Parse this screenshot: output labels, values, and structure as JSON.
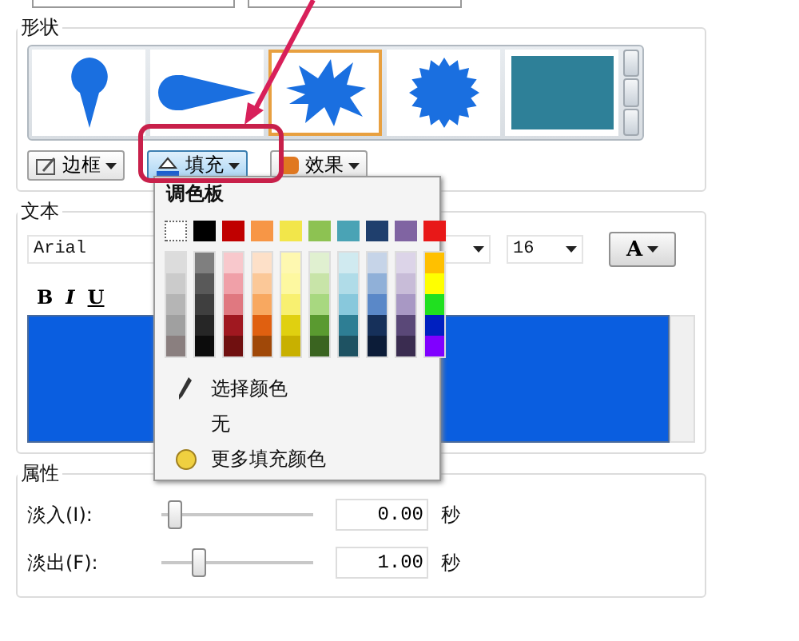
{
  "shape_group": {
    "title": "形状",
    "shapes": [
      {
        "kind": "pin",
        "selected": false
      },
      {
        "kind": "teardrop",
        "selected": false
      },
      {
        "kind": "burst",
        "selected": true
      },
      {
        "kind": "seal",
        "selected": false
      },
      {
        "kind": "rectangle",
        "selected": false
      }
    ],
    "buttons": [
      {
        "kind": "border",
        "label": "边框",
        "selected": false
      },
      {
        "kind": "fill",
        "label": "填充",
        "selected": true
      },
      {
        "kind": "effect",
        "label": "效果",
        "selected": false
      }
    ]
  },
  "text_group": {
    "title": "文本",
    "font": "Arial",
    "size": "16",
    "font_color_label": "A",
    "format_buttons": [
      {
        "kind": "bold",
        "label": "B"
      },
      {
        "kind": "italic",
        "label": "I"
      },
      {
        "kind": "underline",
        "label": "U"
      }
    ]
  },
  "fill_menu": {
    "title": "调色板",
    "top_colors": [
      {
        "kind": "none"
      },
      {
        "kind": "color",
        "color": "#000000"
      },
      {
        "kind": "color",
        "color": "#c00000"
      },
      {
        "kind": "color",
        "color": "#f79646"
      },
      {
        "kind": "color",
        "color": "#f2e64a"
      },
      {
        "kind": "color",
        "color": "#8dc252"
      },
      {
        "kind": "color",
        "color": "#4aa3b5"
      },
      {
        "kind": "color",
        "color": "#1f3f6d"
      },
      {
        "kind": "color",
        "color": "#8064a2"
      },
      {
        "kind": "color",
        "color": "#e81818"
      }
    ],
    "shade_columns": [
      {
        "shades": [
          {
            "color": "#dcdcdc"
          },
          {
            "color": "#cbcbcb"
          },
          {
            "color": "#b5b5b5"
          },
          {
            "color": "#a0a0a0"
          },
          {
            "color": "#8a7f7f"
          }
        ]
      },
      {
        "shades": [
          {
            "color": "#7f7f7f"
          },
          {
            "color": "#595959"
          },
          {
            "color": "#3f3f3f"
          },
          {
            "color": "#262626"
          },
          {
            "color": "#0c0c0c"
          }
        ]
      },
      {
        "shades": [
          {
            "color": "#f8c8cc"
          },
          {
            "color": "#f0a0a8"
          },
          {
            "color": "#e07880"
          },
          {
            "color": "#a01820"
          },
          {
            "color": "#701010"
          }
        ]
      },
      {
        "shades": [
          {
            "color": "#fde0c8"
          },
          {
            "color": "#fbc898"
          },
          {
            "color": "#f8a860"
          },
          {
            "color": "#e06010"
          },
          {
            "color": "#a04808"
          }
        ]
      },
      {
        "shades": [
          {
            "color": "#fef8b0"
          },
          {
            "color": "#fdf8a0"
          },
          {
            "color": "#f8f070"
          },
          {
            "color": "#e0d010"
          },
          {
            "color": "#c8b000"
          }
        ]
      },
      {
        "shades": [
          {
            "color": "#e0f0d0"
          },
          {
            "color": "#c8e4a8"
          },
          {
            "color": "#a8d880"
          },
          {
            "color": "#5a9a30"
          },
          {
            "color": "#3a6420"
          }
        ]
      },
      {
        "shades": [
          {
            "color": "#d0eaf0"
          },
          {
            "color": "#b0dce8"
          },
          {
            "color": "#88c8dc"
          },
          {
            "color": "#2e7e94"
          },
          {
            "color": "#1e5262"
          }
        ]
      },
      {
        "shades": [
          {
            "color": "#c6d4e8"
          },
          {
            "color": "#90b0d8"
          },
          {
            "color": "#5a88c8"
          },
          {
            "color": "#16305a"
          },
          {
            "color": "#0c1c38"
          }
        ]
      },
      {
        "shades": [
          {
            "color": "#dcd4e8"
          },
          {
            "color": "#c8bcd8"
          },
          {
            "color": "#a898c4"
          },
          {
            "color": "#5a4878"
          },
          {
            "color": "#3a2c50"
          }
        ]
      },
      {
        "shades": [
          {
            "color": "#ffc000"
          },
          {
            "color": "#ffff00"
          },
          {
            "color": "#20e020"
          },
          {
            "color": "#0020c0"
          },
          {
            "color": "#8000ff"
          }
        ]
      }
    ],
    "items": [
      {
        "kind": "picker",
        "label": "选择颜色"
      },
      {
        "kind": "plain",
        "label": "无"
      },
      {
        "kind": "more",
        "label": "更多填充颜色"
      }
    ]
  },
  "props_group": {
    "title": "属性",
    "rows": [
      {
        "label": "淡入(I):",
        "level": 0.05,
        "value": "0.00",
        "unit": "秒"
      },
      {
        "label": "淡出(F):",
        "level": 0.22,
        "value": "1.00",
        "unit": "秒"
      }
    ]
  }
}
